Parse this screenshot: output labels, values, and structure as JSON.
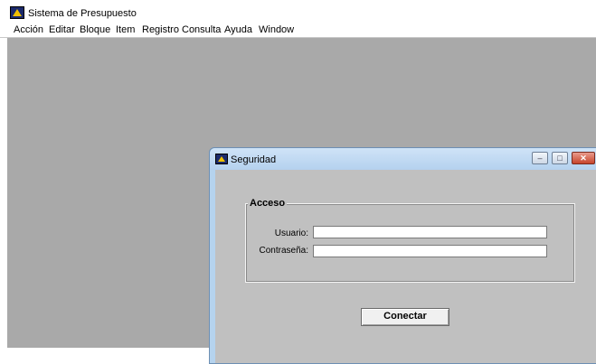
{
  "app": {
    "title": "Sistema de Presupuesto"
  },
  "menubar": {
    "items": [
      "Acción",
      "Editar",
      "Bloque",
      "Item",
      "Registro",
      "Consulta",
      "Ayuda",
      "Window"
    ]
  },
  "dialog": {
    "title": "Seguridad",
    "group_title": "Acceso",
    "user_label": "Usuario:",
    "user_value": "",
    "password_label": "Contraseña:",
    "password_value": "",
    "connect_label": "Conectar",
    "controls": {
      "minimize": "–",
      "maximize": "□",
      "close": "✕"
    }
  },
  "colors": {
    "mdi_background": "#a9a9a9",
    "dialog_frame": "#b5d3ee",
    "dialog_body": "#c0c0c0",
    "close_button": "#c7442c"
  },
  "icons": [
    "app-icon",
    "dialog-icon"
  ]
}
